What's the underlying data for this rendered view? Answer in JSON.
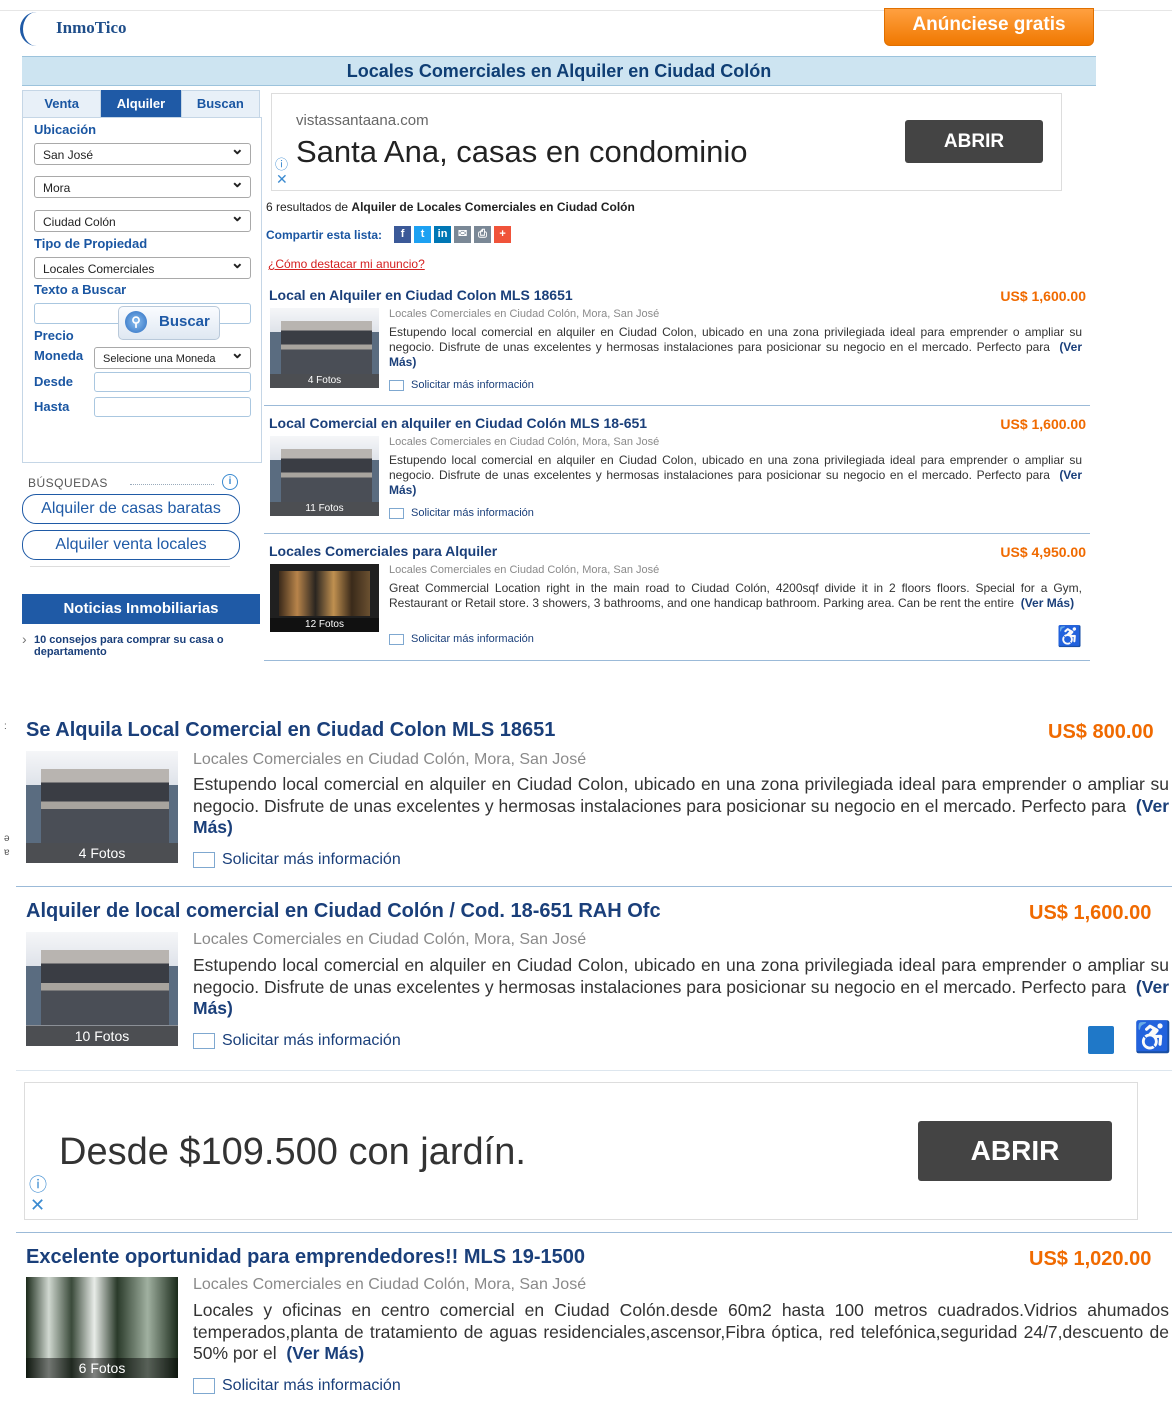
{
  "header": {
    "logo_text": "InmoTico",
    "announce_label": "Anúnciese gratis",
    "page_title": "Locales Comerciales en Alquiler en Ciudad Colón"
  },
  "sidebar": {
    "tabs": [
      "Venta",
      "Alquiler",
      "Buscan"
    ],
    "active_tab": "Alquiler",
    "ubicacion_label": "Ubicación",
    "province": "San José",
    "canton": "Mora",
    "district": "Ciudad Colón",
    "tipo_label": "Tipo de Propiedad",
    "tipo_value": "Locales Comerciales",
    "texto_label": "Texto a Buscar",
    "precio_label": "Precio",
    "moneda_label": "Moneda",
    "moneda_value": "Selecione una Moneda",
    "desde_label": "Desde",
    "hasta_label": "Hasta",
    "search_label": "Buscar",
    "busquedas_label": "BÚSQUEDAS",
    "saved_searches": [
      "Alquiler de casas baratas",
      "Alquiler venta locales"
    ],
    "news_title": "Noticias Inmobiliarias",
    "news_item": "10 consejos para comprar su casa o departamento"
  },
  "ads": [
    {
      "domain": "vistassantaana.com",
      "headline": "Santa Ana, casas en condominio",
      "button": "ABRIR"
    },
    {
      "domain": "",
      "headline": "Desde $109.500 con jardín.",
      "button": "ABRIR"
    }
  ],
  "results": {
    "count_text": "6 resultados de",
    "count_bold": "Alquiler de Locales Comerciales en Ciudad Colón",
    "share_label": "Compartir esta lista:",
    "highlight_link": "¿Cómo destacar mi anuncio?"
  },
  "icons": {
    "share": [
      "facebook-icon",
      "twitter-icon",
      "linkedin-icon",
      "email-icon",
      "print-icon",
      "plus-icon"
    ],
    "search": "magnifier-icon",
    "request": "envelope-icon",
    "badges": [
      "book-icon",
      "accessibility-icon"
    ]
  },
  "common": {
    "location": "Locales Comerciales en Ciudad Colón, Mora, San José",
    "more": "(Ver Más)",
    "request": "Solicitar más información"
  },
  "listings": [
    {
      "title": "Local en Alquiler en Ciudad Colon MLS 18651",
      "price": "US$ 1,600.00",
      "photos": "4 Fotos",
      "desc": "Estupendo local comercial en alquiler en Ciudad Colon, ubicado en una zona privilegiada ideal para emprender o ampliar su negocio. Disfrute de unas excelentes y hermosas instalaciones para posicionar su negocio en el mercado. Perfecto para"
    },
    {
      "title": "Local Comercial en alquiler en Ciudad Colón MLS 18-651",
      "price": "US$ 1,600.00",
      "photos": "11 Fotos",
      "desc": "Estupendo local comercial en alquiler en Ciudad Colon, ubicado en una zona privilegiada ideal para emprender o ampliar su negocio. Disfrute de unas excelentes y hermosas instalaciones para posicionar su negocio en el mercado. Perfecto para"
    },
    {
      "title": "Locales Comerciales para Alquiler",
      "price": "US$ 4,950.00",
      "photos": "12 Fotos",
      "desc": "Great Commercial Location right in the main road to Ciudad Colón, 4200sqf divide it in 2 floors floors. Special for a Gym, Restaurant or Retail store. 3 showers, 3 bathrooms, and one handicap bathroom. Parking area. Can be rent the entire"
    },
    {
      "title": "Se Alquila Local Comercial en Ciudad Colon MLS 18651",
      "price": "US$ 800.00",
      "photos": "4 Fotos",
      "desc": "Estupendo local comercial en alquiler en Ciudad Colon, ubicado en una zona privilegiada ideal para emprender o ampliar su negocio. Disfrute de unas excelentes y hermosas instalaciones para posicionar su negocio en el mercado. Perfecto para"
    },
    {
      "title": "Alquiler de local comercial en Ciudad Colón / Cod. 18-651 RAH Ofc",
      "price": "US$ 1,600.00",
      "photos": "10 Fotos",
      "desc": "Estupendo local comercial en alquiler en Ciudad Colon, ubicado en una zona privilegiada ideal para emprender o ampliar su negocio. Disfrute de unas excelentes y hermosas instalaciones para posicionar su negocio en el mercado. Perfecto para"
    },
    {
      "title": "Excelente oportunidad para emprendedores!! MLS 19-1500",
      "price": "US$ 1,020.00",
      "photos": "6 Fotos",
      "desc": "Locales y oficinas en centro comercial en Ciudad Colón.desde 60m2 hasta 100 metros cuadrados.Vidrios ahumados temperados,planta de tratamiento de aguas residenciales,ascensor,Fibra óptica, red telefónica,seguridad 24/7,descuento de 50% por el"
    }
  ]
}
